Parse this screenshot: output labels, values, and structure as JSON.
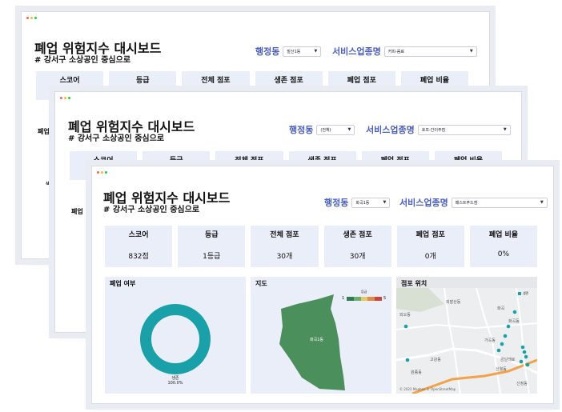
{
  "back_window": {
    "title": "폐업 위험지수 대시보드",
    "subtitle": "# 강서구 소상공인 중심으로",
    "filter_dong_label": "행정동",
    "filter_dong_value": "발산1동",
    "filter_biz_label": "서비스업종명",
    "filter_biz_value": "커피-음료",
    "kpi_labels": [
      "스코어",
      "등급",
      "전체 점포",
      "생존 점포",
      "폐업 점포",
      "폐업 비율"
    ],
    "side_text_1": "폐업",
    "side_text_2": "색"
  },
  "middle_window": {
    "title": "폐업 위험지수 대시보드",
    "subtitle": "# 강서구 소상공인 중심으로",
    "filter_dong_label": "행정동",
    "filter_dong_value": "(전체)",
    "filter_biz_label": "서비스업종명",
    "filter_biz_value": "호프-간이주점",
    "kpi_labels": [
      "스코어",
      "등급",
      "전체 점포",
      "생존 점포",
      "폐업 점포",
      "폐업 비율"
    ],
    "side_text_1": "폐업"
  },
  "front_window": {
    "title": "폐업 위험지수 대시보드",
    "subtitle": "# 강서구 소상공인 중심으로",
    "filter_dong_label": "행정동",
    "filter_dong_value": "화곡1동",
    "filter_biz_label": "서비스업종명",
    "filter_biz_value": "패스트푸드점",
    "kpis": [
      {
        "label": "스코어",
        "value": "832점"
      },
      {
        "label": "등급",
        "value": "1등급"
      },
      {
        "label": "전체 점포",
        "value": "30개"
      },
      {
        "label": "생존 점포",
        "value": "30개"
      },
      {
        "label": "폐업 점포",
        "value": "0개"
      },
      {
        "label": "폐업 비율",
        "value": "0%"
      }
    ],
    "closure_panel": {
      "title": "폐업 여부",
      "donut_label": "생존",
      "donut_value": "100.0%",
      "survive_fraction": 1.0,
      "color": "#1aa0a8"
    },
    "map_panel": {
      "title": "지도",
      "legend_title": "등급",
      "legend_min": "1",
      "legend_max": "5",
      "legend_colors": [
        "#2e7d4f",
        "#6cae6a",
        "#e8c866",
        "#e08a4a",
        "#c8463a"
      ],
      "region_label": "화곡1동",
      "region_color": "#4a8f5c"
    },
    "location_panel": {
      "title": "점포 위치",
      "legend_label": "생존",
      "point_color": "#1aa0a8",
      "labels": [
        "외발산동",
        "화곡동",
        "가곡동",
        "고강동",
        "원종동",
        "곰달래로",
        "신월동",
        "외오동",
        "신정동",
        "화곡"
      ],
      "attribution": "© 2023 Mapbox © OpenStreetMap"
    }
  }
}
